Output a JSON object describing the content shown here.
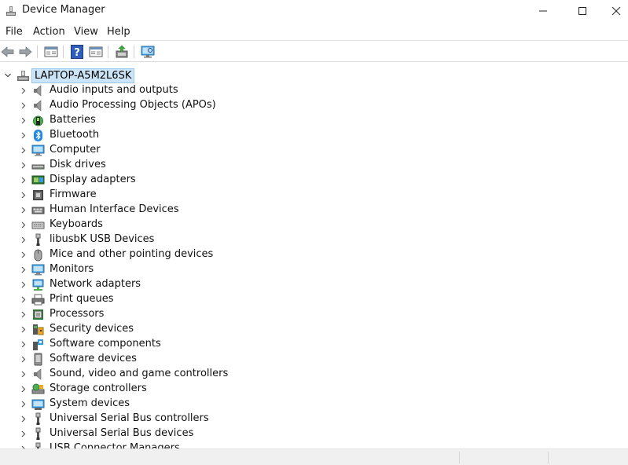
{
  "window": {
    "title": "Device Manager"
  },
  "menu": [
    "File",
    "Action",
    "View",
    "Help"
  ],
  "toolbar": {
    "buttons": [
      "back-icon",
      "forward-icon",
      "properties-pane-icon",
      "help-icon",
      "show-hidden-icon",
      "update-driver-icon",
      "scan-hardware-icon"
    ]
  },
  "tree": {
    "root": "LAPTOP-A5M2L6SK",
    "items": [
      {
        "label": "Audio inputs and outputs",
        "icon": "speaker-icon"
      },
      {
        "label": "Audio Processing Objects (APOs)",
        "icon": "speaker-icon"
      },
      {
        "label": "Batteries",
        "icon": "battery-icon"
      },
      {
        "label": "Bluetooth",
        "icon": "bluetooth-icon"
      },
      {
        "label": "Computer",
        "icon": "computer-icon"
      },
      {
        "label": "Disk drives",
        "icon": "disk-drive-icon"
      },
      {
        "label": "Display adapters",
        "icon": "display-adapter-icon"
      },
      {
        "label": "Firmware",
        "icon": "firmware-icon"
      },
      {
        "label": "Human Interface Devices",
        "icon": "hid-icon"
      },
      {
        "label": "Keyboards",
        "icon": "keyboard-icon"
      },
      {
        "label": "libusbK USB Devices",
        "icon": "usb-icon"
      },
      {
        "label": "Mice and other pointing devices",
        "icon": "mouse-icon"
      },
      {
        "label": "Monitors",
        "icon": "monitor-icon"
      },
      {
        "label": "Network adapters",
        "icon": "network-icon"
      },
      {
        "label": "Print queues",
        "icon": "printer-icon"
      },
      {
        "label": "Processors",
        "icon": "processor-icon"
      },
      {
        "label": "Security devices",
        "icon": "security-device-icon"
      },
      {
        "label": "Software components",
        "icon": "software-component-icon"
      },
      {
        "label": "Software devices",
        "icon": "software-device-icon"
      },
      {
        "label": "Sound, video and game controllers",
        "icon": "speaker-icon"
      },
      {
        "label": "Storage controllers",
        "icon": "storage-controller-icon"
      },
      {
        "label": "System devices",
        "icon": "system-device-icon"
      },
      {
        "label": "Universal Serial Bus controllers",
        "icon": "usb-icon"
      },
      {
        "label": "Universal Serial Bus devices",
        "icon": "usb-icon"
      },
      {
        "label": "USB Connector Managers",
        "icon": "usb-icon"
      }
    ]
  },
  "colors": {
    "selection": "#cce4f7",
    "accent": "#0078d7"
  }
}
